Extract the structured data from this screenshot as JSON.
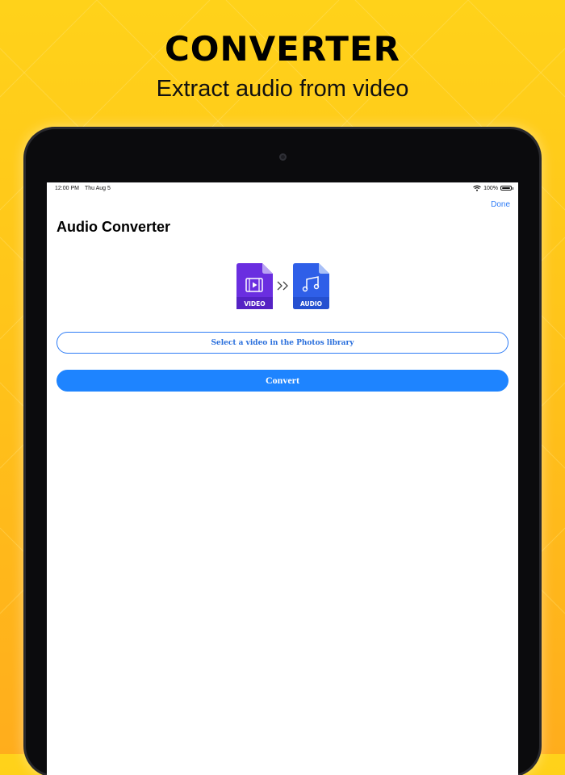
{
  "promo": {
    "headline": "CONVERTER",
    "subheadline": "Extract audio from video"
  },
  "status_bar": {
    "time": "12:00 PM",
    "date": "Thu Aug 5",
    "battery": "100%"
  },
  "nav": {
    "done_label": "Done",
    "title": "Audio Converter"
  },
  "conversion_graphic": {
    "from_label": "VIDEO",
    "to_label": "AUDIO",
    "from_color": "#6a2ee0",
    "to_color": "#2f5fe8"
  },
  "actions": {
    "select_label": "Select a video in the Photos library",
    "convert_label": "Convert"
  },
  "colors": {
    "accent": "#1e84ff",
    "background_top": "#ffd21a",
    "background_bottom": "#ffad1c"
  }
}
